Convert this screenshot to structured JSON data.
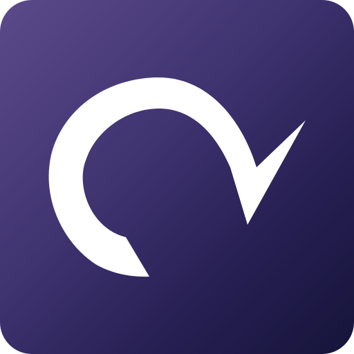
{
  "app_icon": {
    "icon": "arc-arrow-check-icon",
    "colors": {
      "background_top_left": "#5c4a8a",
      "background_bottom_right": "#16143a",
      "glyph": "#ffffff"
    }
  }
}
